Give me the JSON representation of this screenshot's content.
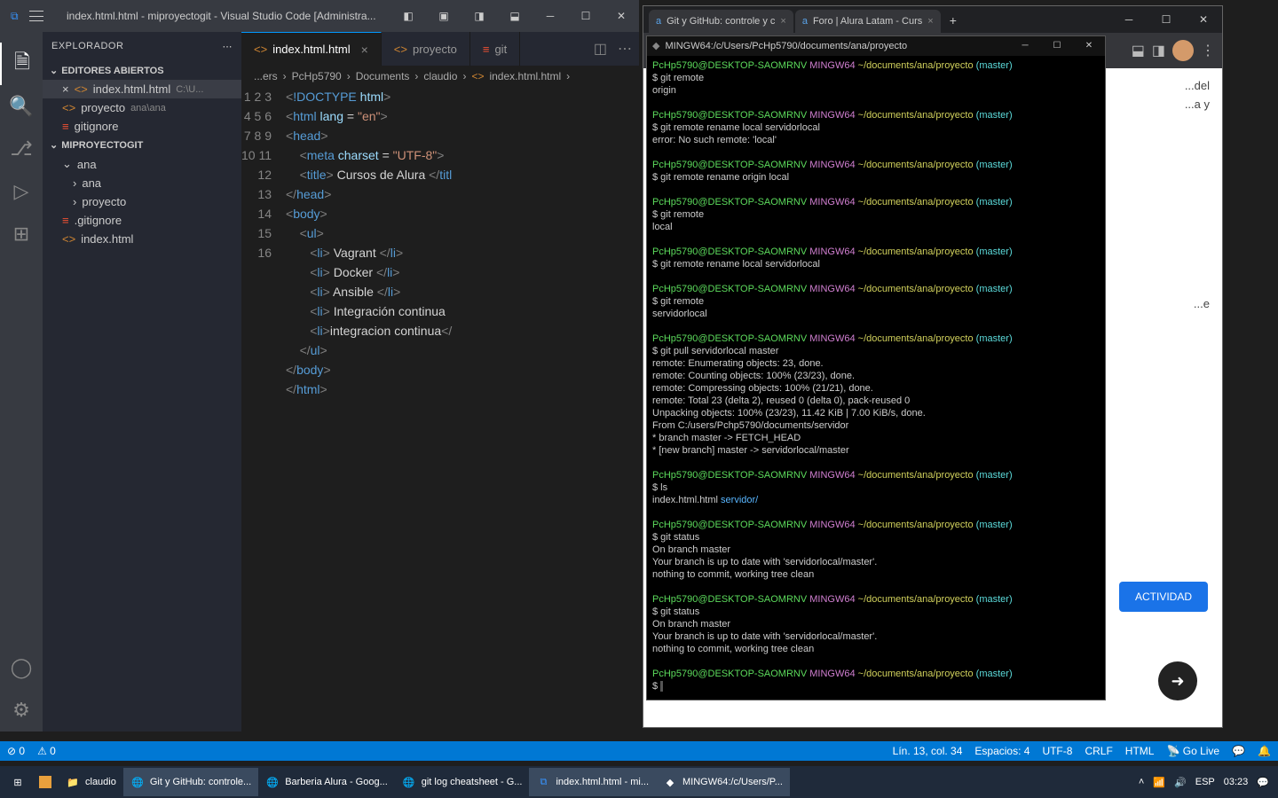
{
  "vscode": {
    "title": "index.html.html - miproyectogit - Visual Studio Code [Administra...",
    "explorer_label": "EXPLORADOR",
    "open_editors_label": "EDITORES ABIERTOS",
    "open_editors": [
      {
        "name": "index.html.html",
        "hint": "C:\\U..."
      },
      {
        "name": "proyecto",
        "hint": "ana\\ana"
      },
      {
        "name": "gitignore",
        "hint": ""
      }
    ],
    "project_label": "MIPROYECTOGIT",
    "tree": {
      "ana": "ana",
      "ana_sub": "ana",
      "proyecto": "proyecto",
      "gitignore": ".gitignore",
      "index": "index.html"
    },
    "tabs": [
      {
        "name": "index.html.html",
        "active": true
      },
      {
        "name": "proyecto",
        "active": false
      },
      {
        "name": "git",
        "active": false
      }
    ],
    "breadcrumb": [
      "...ers",
      "PcHp5790",
      "Documents",
      "claudio",
      "index.html.html"
    ],
    "code_title": "Cursos de Alura",
    "code_items": [
      "Vagrant",
      "Docker",
      "Ansible",
      "Integración continua",
      "integracion continua"
    ],
    "status": {
      "errors": "0",
      "warnings": "0",
      "line_col": "Lín. 13, col. 34",
      "spaces": "Espacios: 4",
      "encoding": "UTF-8",
      "eol": "CRLF",
      "lang": "HTML",
      "golive": "Go Live"
    }
  },
  "browser": {
    "tabs": [
      {
        "title": "Git y GitHub: controle y c"
      },
      {
        "title": "Foro | Alura Latam - Curs"
      }
    ],
    "body_text1": "...del",
    "body_text2": "...a y",
    "body_text3": "...e",
    "activity_button": "ACTIVIDAD"
  },
  "terminal": {
    "title": "MINGW64:/c/Users/PcHp5790/documents/ana/proyecto",
    "user": "PcHp5790@DESKTOP-SAOMRNV",
    "mingw": "MINGW64",
    "path": "~/documents/ana/proyecto",
    "branch": "(master)",
    "blocks": [
      {
        "cmd": "git remote",
        "out": [
          "origin"
        ]
      },
      {
        "cmd": "git remote rename local servidorlocal",
        "out": [
          "error: No such remote: 'local'"
        ]
      },
      {
        "cmd": "git remote rename origin local",
        "out": []
      },
      {
        "cmd": "git remote",
        "out": [
          "local"
        ]
      },
      {
        "cmd": "git remote rename local servidorlocal",
        "out": []
      },
      {
        "cmd": "git remote",
        "out": [
          "servidorlocal"
        ]
      },
      {
        "cmd": "git pull servidorlocal master",
        "out": [
          "remote: Enumerating objects: 23, done.",
          "remote: Counting objects: 100% (23/23), done.",
          "remote: Compressing objects: 100% (21/21), done.",
          "remote: Total 23 (delta 2), reused 0 (delta 0), pack-reused 0",
          "Unpacking objects: 100% (23/23), 11.42 KiB | 7.00 KiB/s, done.",
          "From C:/users/Pchp5790/documents/servidor",
          " * branch            master     -> FETCH_HEAD",
          " * [new branch]      master     -> servidorlocal/master"
        ]
      },
      {
        "cmd": "ls",
        "out": [
          "index.html.html  servidor/"
        ]
      },
      {
        "cmd": "git status",
        "out": [
          "On branch master",
          "Your branch is up to date with 'servidorlocal/master'.",
          "",
          "nothing to commit, working tree clean"
        ]
      },
      {
        "cmd": "git status",
        "out": [
          "On branch master",
          "Your branch is up to date with 'servidorlocal/master'.",
          "",
          "nothing to commit, working tree clean"
        ]
      }
    ],
    "ls_file": "index.html.html",
    "ls_dir": "servidor/"
  },
  "taskbar": {
    "folder": "claudio",
    "items": [
      "Git y GitHub: controle...",
      "Barberia Alura - Goog...",
      "git log cheatsheet - G...",
      "index.html.html - mi...",
      "MINGW64:/c/Users/P..."
    ],
    "lang": "ESP",
    "time": "03:23"
  }
}
